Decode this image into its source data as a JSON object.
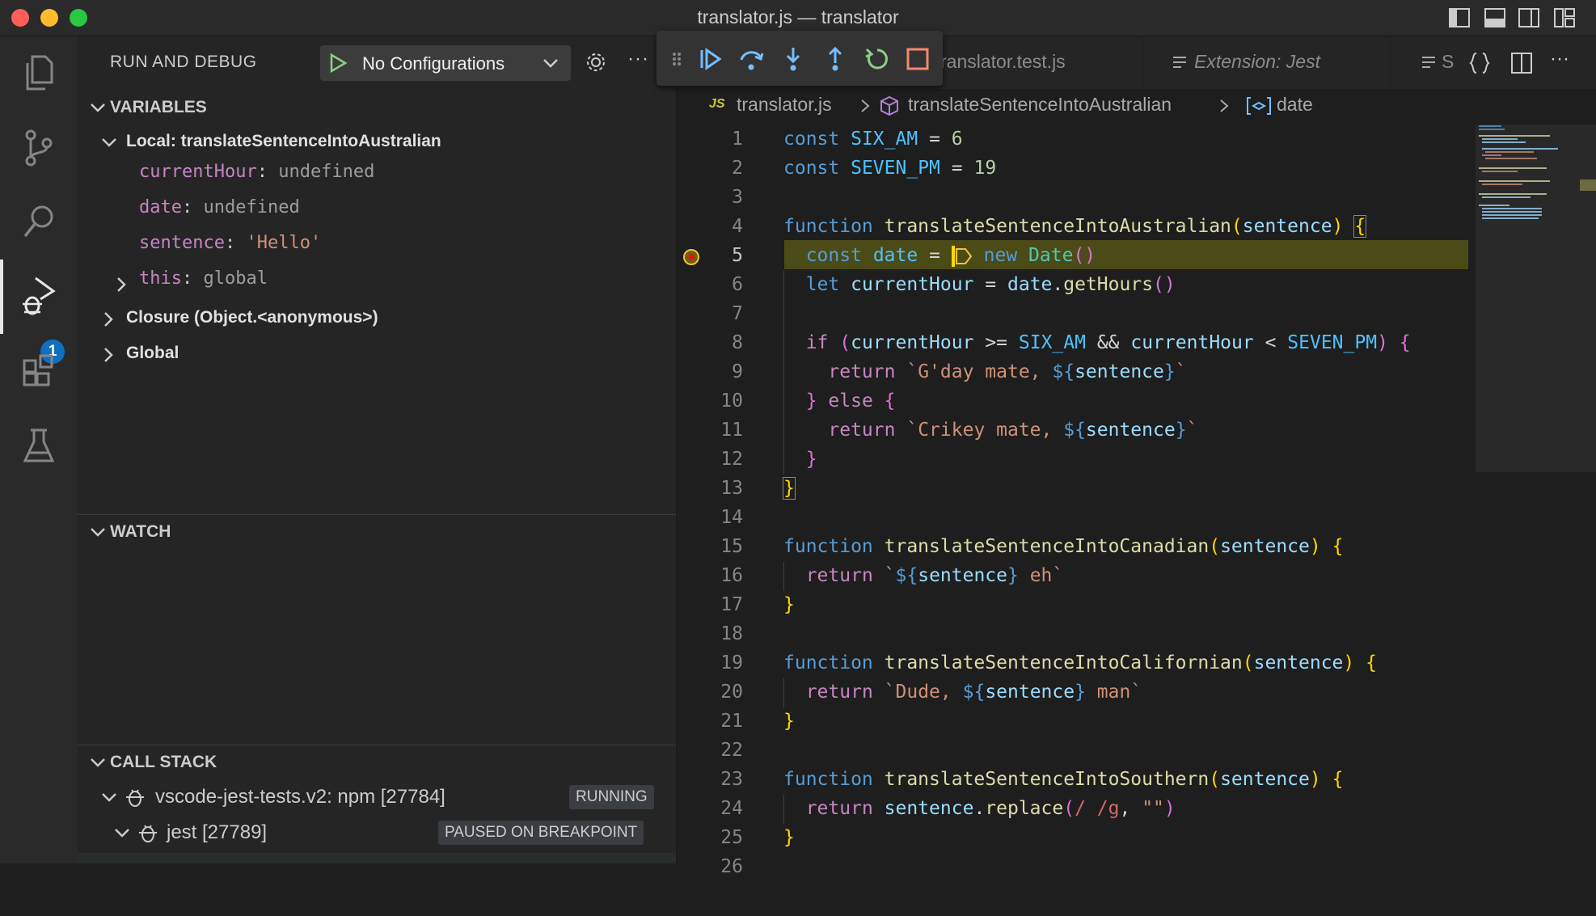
{
  "window": {
    "title": "translator.js — translator"
  },
  "colors": {
    "accent": "#0e70c0",
    "background": "#1e1e1e",
    "sidebar": "#252526",
    "current_line": "#4b4b18",
    "breakpoint": "#f4c430"
  },
  "activity_bar": {
    "items": [
      "files-icon",
      "source-control-icon",
      "search-icon",
      "run-debug-icon",
      "extensions-icon",
      "testing-icon"
    ],
    "debug_badge": "1"
  },
  "sidebar": {
    "title": "RUN AND DEBUG",
    "config_label": "No Configurations",
    "more": "···",
    "variables": {
      "title": "VARIABLES",
      "local_scope": "Local: translateSentenceIntoAustralian",
      "vars": [
        {
          "name": "currentHour",
          "value": "undefined"
        },
        {
          "name": "date",
          "value": "undefined"
        },
        {
          "name": "sentence",
          "value": "'Hello'"
        },
        {
          "name": "this",
          "value": "global"
        }
      ],
      "closure_scope": "Closure (Object.<anonymous>)",
      "global_scope": "Global"
    },
    "watch": {
      "title": "WATCH"
    },
    "call_stack": {
      "title": "CALL STACK",
      "sessions": [
        {
          "name": "vscode-jest-tests.v2: npm [27784]",
          "status": "RUNNING"
        },
        {
          "name": "jest [27789]",
          "status": "PAUSED ON BREAKPOINT"
        }
      ]
    }
  },
  "tabs": [
    {
      "label": "ranslator.test.js",
      "icon": ""
    },
    {
      "label": "Extension: Jest",
      "icon": "preview-icon"
    },
    {
      "label": "S",
      "icon": "preview-icon"
    }
  ],
  "breadcrumb": {
    "file_icon": "JS",
    "file": "translator.js",
    "symbol": "translateSentenceIntoAustralian",
    "variable": "date"
  },
  "editor": {
    "current_line": 5,
    "line_numbers": [
      "1",
      "2",
      "3",
      "4",
      "5",
      "6",
      "7",
      "8",
      "9",
      "10",
      "11",
      "12",
      "13",
      "14",
      "15",
      "16",
      "17",
      "18",
      "19",
      "20",
      "21",
      "22",
      "23",
      "24",
      "25",
      "26"
    ],
    "strings": {
      "six_am_value": "6",
      "seven_pm_value": "19",
      "gday": "G'day mate, ",
      "crikey": "Crikey mate, ",
      "eh": " eh",
      "dude": "Dude, ",
      "man": " man",
      "regex": "/ /g",
      "empty_string": "\"\""
    }
  }
}
